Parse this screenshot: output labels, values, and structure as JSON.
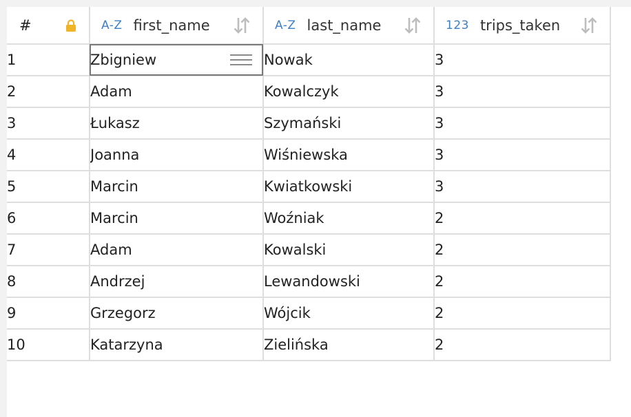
{
  "columns": {
    "index": {
      "label": "#",
      "icon": "lock-icon"
    },
    "first_name": {
      "type_label": "A-Z",
      "label": "first_name",
      "icon": "sort-icon"
    },
    "last_name": {
      "type_label": "A-Z",
      "label": "last_name",
      "icon": "sort-icon"
    },
    "trips_taken": {
      "type_label": "123",
      "label": "trips_taken",
      "icon": "sort-icon"
    }
  },
  "rows": [
    {
      "num": "1",
      "first_name": "Zbigniew",
      "last_name": "Nowak",
      "trips_taken": "3"
    },
    {
      "num": "2",
      "first_name": "Adam",
      "last_name": "Kowalczyk",
      "trips_taken": "3"
    },
    {
      "num": "3",
      "first_name": "Łukasz",
      "last_name": "Szymański",
      "trips_taken": "3"
    },
    {
      "num": "4",
      "first_name": "Joanna",
      "last_name": "Wiśniewska",
      "trips_taken": "3"
    },
    {
      "num": "5",
      "first_name": "Marcin",
      "last_name": "Kwiatkowski",
      "trips_taken": "3"
    },
    {
      "num": "6",
      "first_name": "Marcin",
      "last_name": "Woźniak",
      "trips_taken": "2"
    },
    {
      "num": "7",
      "first_name": "Adam",
      "last_name": "Kowalski",
      "trips_taken": "2"
    },
    {
      "num": "8",
      "first_name": "Andrzej",
      "last_name": "Lewandowski",
      "trips_taken": "2"
    },
    {
      "num": "9",
      "first_name": "Grzegorz",
      "last_name": "Wójcik",
      "trips_taken": "2"
    },
    {
      "num": "10",
      "first_name": "Katarzyna",
      "last_name": "Zielińska",
      "trips_taken": "2"
    }
  ],
  "selection": {
    "row": 0,
    "column": "first_name"
  },
  "colors": {
    "type_icon": "#3d7fc6",
    "lock": "#f0b429",
    "grid_line": "#dedede",
    "selection": "#7a7a7a"
  }
}
